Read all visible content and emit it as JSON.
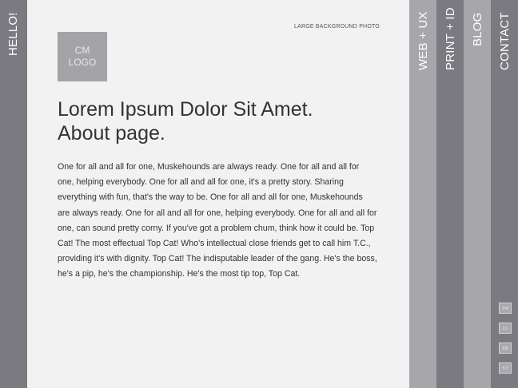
{
  "side_nav": {
    "hello_label": "HELLO!"
  },
  "header": {
    "background_label": "LARGE BACKGROUND PHOTO"
  },
  "logo": {
    "line1": "CM",
    "line2": "LOGO"
  },
  "content": {
    "title_line1": "Lorem Ipsum Dolor Sit Amet.",
    "title_line2": "About page.",
    "body": "One for all and all for one, Muskehounds are always ready. One for all and all for one, helping everybody. One for all and all for one, it's a pretty story. Sharing everything with fun, that's the way to be. One for all and all for one, Muskehounds are always ready. One for all and all for one, helping everybody. One for all and all for one, can sound pretty corny. If you've got a problem chum, think how it could be. Top Cat! The most effectual Top Cat! Who's intellectual close friends get to call him T.C., providing it's with dignity. Top Cat! The indisputable leader of the gang. He's the boss, he's a pip, he's the championship. He's the most tip top, Top Cat."
  },
  "nav": {
    "web": "WEB + UX",
    "print": "PRINT + ID",
    "blog": "BLOG",
    "contact": "CONTACT"
  },
  "social": [
    "TW",
    "LI",
    "FB",
    "YT"
  ],
  "colors": {
    "dark_bar": "#7b7a80",
    "light_bar": "#a6a6ab",
    "page_bg": "#f2f2f2"
  }
}
